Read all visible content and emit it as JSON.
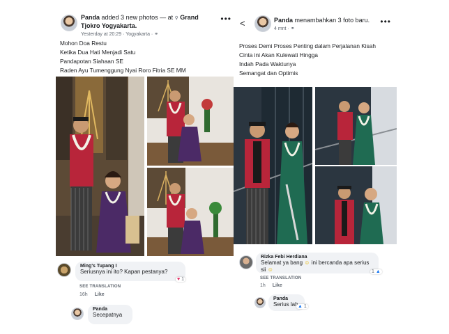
{
  "left_post": {
    "author": "Panda",
    "action_text": "added 3 new photos — at",
    "location": "Grand Tjokro Yogyakarta.",
    "timestamp": "Yesterday at 20:29 · Yogyakarta ·",
    "more_icon": "•••",
    "caption_lines": [
      "Mohon Doa Restu",
      "Ketika Dua Hati Menjadi Satu",
      "Pandapotan Siahaan SE",
      "Raden Ayu Tumenggung Nyai Roro Fitria SE MM"
    ],
    "comments": [
      {
        "name": "Ming's Tupang I",
        "text": "Seriusnya ini ito?  Kapan pestanya?",
        "see_translation": "SEE TRANSLATION",
        "time": "16h",
        "like": "Like",
        "reaction_count": "1"
      },
      {
        "name": "Panda",
        "text": "Secepatnya"
      }
    ]
  },
  "right_post": {
    "back_icon": "<",
    "author": "Panda",
    "action_text": "menambahkan 3 foto baru.",
    "timestamp": "4 mnt ·",
    "more_icon": "•••",
    "caption_lines": [
      "Proses Demi Proses Penting dalam Perjalanan Kisah",
      "Cinta ini Akan Kulewati Hingga",
      "Indah Pada Waktunya",
      "Semangat dan Optimis"
    ],
    "comments": [
      {
        "name": "Rizka Febi Herdiana",
        "text_a": "Selamat ya bang",
        "text_b": "ini bercanda apa serius sii",
        "see_translation": "SEE TRANSLATION",
        "time": "1h",
        "like": "Like",
        "reaction_count": "1"
      },
      {
        "name": "Panda",
        "text": "Serius lah",
        "reaction_count": "1"
      }
    ]
  },
  "colors": {
    "link_blue": "#1877f2",
    "bubble_bg": "#f0f2f5",
    "meta_gray": "#606770",
    "groom_jacket": "#b8253a",
    "bride_purple": "#4b2a66",
    "bride_green": "#1f6b52"
  }
}
